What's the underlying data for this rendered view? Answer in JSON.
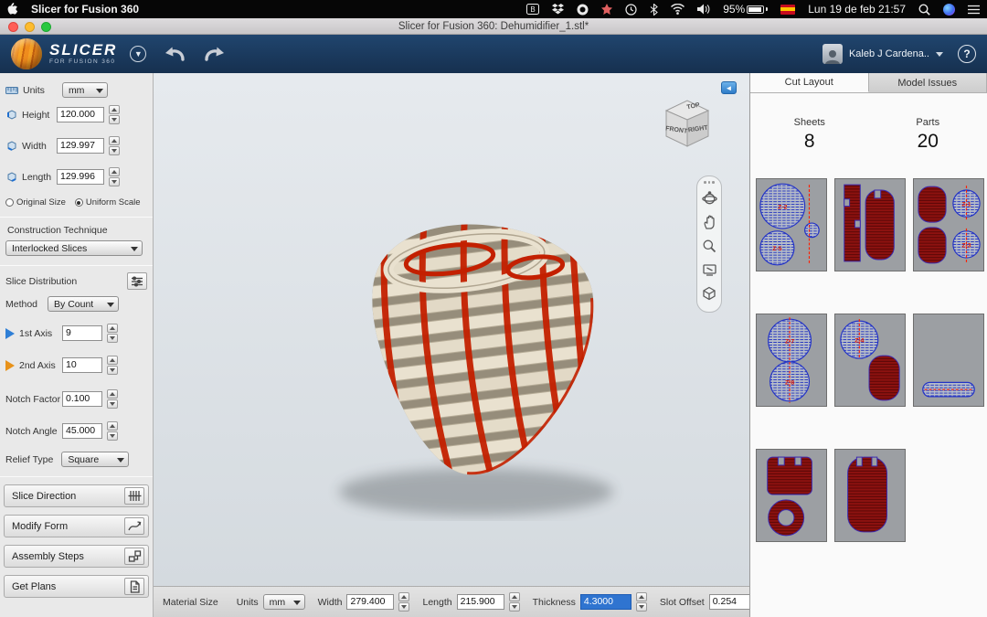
{
  "menu_bar": {
    "app_name": "Slicer for Fusion 360",
    "battery": "95%",
    "datetime": "Lun 19 de feb 21:57"
  },
  "title_bar": {
    "title": "Slicer for Fusion 360: Dehumidifier_1.stl*"
  },
  "header": {
    "logo_title": "SLICER",
    "logo_subtitle": "FOR FUSION 360",
    "user_name": "Kaleb J Cardena..",
    "help_label": "?"
  },
  "sidebar": {
    "units_label": "Units",
    "units_value": "mm",
    "dims": [
      {
        "label": "Height",
        "value": "120.000"
      },
      {
        "label": "Width",
        "value": "129.997"
      },
      {
        "label": "Length",
        "value": "129.996"
      }
    ],
    "scale_options": [
      {
        "label": "Original Size"
      },
      {
        "label": "Uniform Scale"
      }
    ],
    "construction": {
      "title": "Construction Technique",
      "value": "Interlocked Slices"
    },
    "distribution": {
      "title": "Slice Distribution",
      "method_label": "Method",
      "method_value": "By Count",
      "axis1_label": "1st Axis",
      "axis1_value": "9",
      "axis2_label": "2nd Axis",
      "axis2_value": "10",
      "notch_factor_label": "Notch Factor",
      "notch_factor_value": "0.100",
      "notch_angle_label": "Notch Angle",
      "notch_angle_value": "45.000",
      "relief_label": "Relief Type",
      "relief_value": "Square"
    },
    "actions": [
      {
        "label": "Slice Direction"
      },
      {
        "label": "Modify Form"
      },
      {
        "label": "Assembly Steps"
      },
      {
        "label": "Get Plans"
      }
    ]
  },
  "viewport": {
    "viewcube": {
      "top": "TOP",
      "front": "FRONT",
      "right": "RIGHT"
    }
  },
  "material_bar": {
    "title": "Material Size",
    "units_label": "Units",
    "units_value": "mm",
    "fields": [
      {
        "label": "Width",
        "value": "279.400"
      },
      {
        "label": "Length",
        "value": "215.900"
      },
      {
        "label": "Thickness",
        "value": "4.3000"
      },
      {
        "label": "Slot Offset",
        "value": "0.254"
      }
    ]
  },
  "right_panel": {
    "tabs": [
      {
        "label": "Cut Layout"
      },
      {
        "label": "Model Issues"
      }
    ],
    "sheets_label": "Sheets",
    "sheets_count": "8",
    "parts_label": "Parts",
    "parts_count": "20",
    "sheet_labels": {
      "s1a": "Z-2",
      "s1b": "Z-5",
      "s3a": "Z-1",
      "s3b": "Z-3",
      "s4a": "Z-7",
      "s4b": "Z-8",
      "s5a": "Z-4"
    }
  }
}
